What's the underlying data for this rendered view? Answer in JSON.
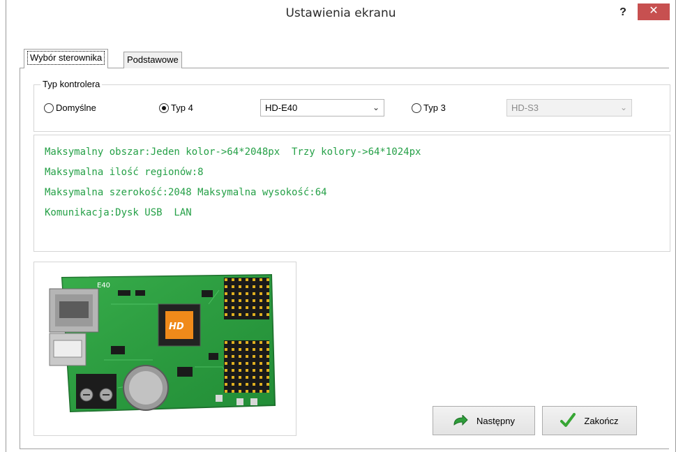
{
  "window": {
    "title": "Ustawienia ekranu",
    "help_label": "?",
    "close_label": "✕"
  },
  "tabs": [
    {
      "label": "Wybór sterownika",
      "active": true
    },
    {
      "label": "Podstawowe",
      "active": false
    }
  ],
  "controller_group": {
    "title": "Typ kontrolera",
    "options": [
      {
        "label": "Domyślne",
        "checked": false
      },
      {
        "label": "Typ 4",
        "checked": true
      },
      {
        "label": "Typ 3",
        "checked": false
      }
    ],
    "type4_select": {
      "value": "HD-E40",
      "enabled": true
    },
    "type3_select": {
      "value": "HD-S3",
      "enabled": false
    }
  },
  "info": {
    "lines": [
      "Maksymalny obszar:Jeden kolor->64*2048px  Trzy kolory->64*1024px",
      "Maksymalna ilość regionów:8",
      "Maksymalna szerokość:2048 Maksymalna wysokość:64",
      "Komunikacja:Dysk USB  LAN"
    ],
    "color": "#25a047"
  },
  "board_image": {
    "model_mark": "E40",
    "chip_mark": "HD"
  },
  "buttons": {
    "next_label": "Następny",
    "finish_label": "Zakończ"
  },
  "colors": {
    "close": "#c75050",
    "accent_green": "#25a047"
  }
}
